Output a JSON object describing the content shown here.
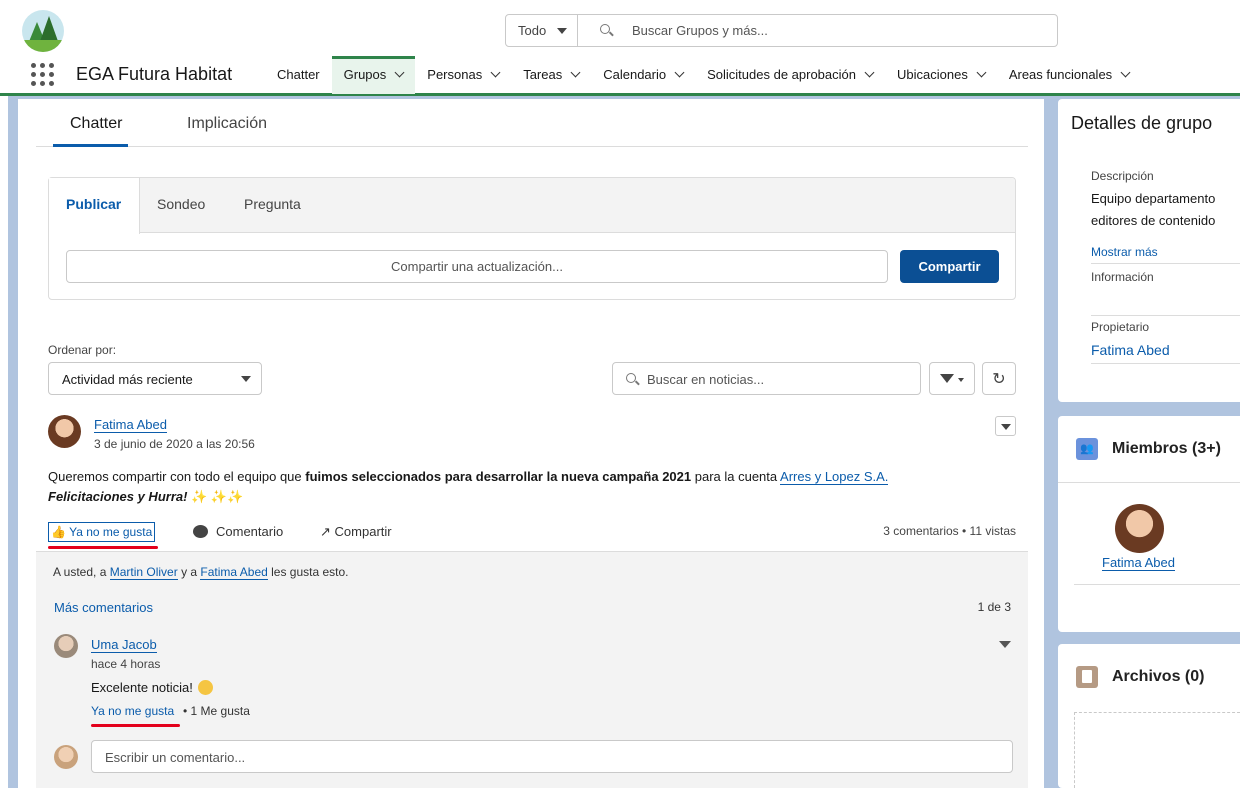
{
  "header": {
    "search_scope": "Todo",
    "search_placeholder": "Buscar Grupos y más...",
    "app_name": "EGA Futura Habitat",
    "nav": [
      {
        "label": "Chatter"
      },
      {
        "label": "Grupos"
      },
      {
        "label": "Personas"
      },
      {
        "label": "Tareas"
      },
      {
        "label": "Calendario"
      },
      {
        "label": "Solicitudes de aprobación"
      },
      {
        "label": "Ubicaciones"
      },
      {
        "label": "Areas funcionales"
      }
    ]
  },
  "main": {
    "tabs": [
      "Chatter",
      "Implicación"
    ],
    "publisher": {
      "tabs": [
        "Publicar",
        "Sondeo",
        "Pregunta"
      ],
      "placeholder": "Compartir una actualización...",
      "share_button": "Compartir"
    },
    "sort": {
      "label": "Ordenar por:",
      "value": "Actividad más reciente"
    },
    "news_search_placeholder": "Buscar en noticias...",
    "post": {
      "author": "Fatima Abed",
      "date": "3 de junio de 2020 a las 20:56",
      "text_1": "Queremos compartir con todo el equipo que ",
      "text_bold": "fuimos seleccionados para desarrollar la nueva campaña 2021",
      "text_2": " para la cuenta ",
      "account_link": "Arres y Lopez S.A.",
      "text_line2": "Felicitaciones y Hurra!",
      "sparkles": "✨ ✨✨",
      "like_label": "Ya no me gusta",
      "comment_label": "Comentario",
      "share_label": "Compartir",
      "stats": "3 comentarios  •  11 vistas"
    },
    "comments": {
      "likers_prefix": "A usted, a ",
      "liker_1": "Martin Oliver",
      "likers_mid": " y a ",
      "liker_2": "Fatima Abed",
      "likers_suffix": " les gusta esto.",
      "more": "Más comentarios",
      "pager": "1 de 3",
      "comment": {
        "author": "Uma Jacob",
        "time": "hace 4 horas",
        "text": "Excelente noticia!",
        "like_label": "Ya no me gusta",
        "likes": "•   1 Me gusta"
      },
      "write_placeholder": "Escribir un comentario..."
    }
  },
  "sidebar": {
    "details": {
      "title": "Detalles de grupo",
      "desc_label": "Descripción",
      "desc_line1": "Equipo departamento",
      "desc_line2": "editores de contenido",
      "show_more": "Mostrar más",
      "info_label": "Información",
      "owner_label": "Propietario",
      "owner": "Fatima Abed"
    },
    "members": {
      "title": "Miembros (3+)",
      "member": "Fatima Abed"
    },
    "files": {
      "title": "Archivos (0)"
    }
  },
  "colors": {
    "brand": "#0b5cab",
    "nav_active": "#2e844a",
    "highlight": "#e3001b"
  }
}
